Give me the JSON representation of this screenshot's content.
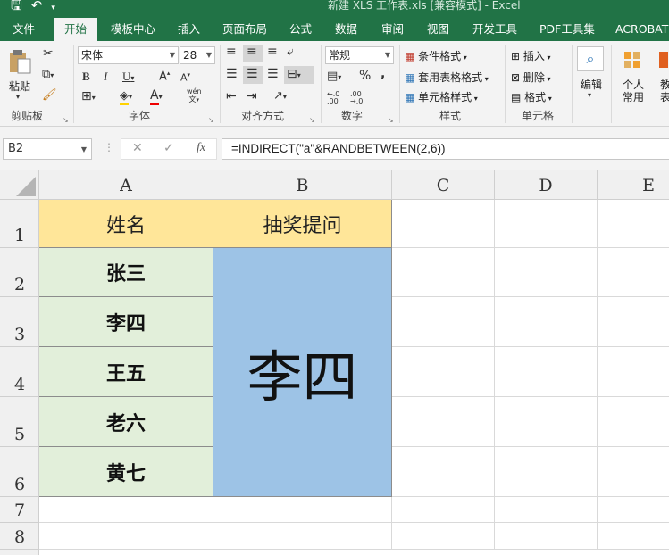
{
  "window": {
    "title": "新建 XLS 工作表.xls  [兼容模式] - Excel"
  },
  "ribbon_tabs": [
    {
      "label": "文件",
      "active": false
    },
    {
      "label": "开始",
      "active": true
    },
    {
      "label": "模板中心",
      "active": false
    },
    {
      "label": "插入",
      "active": false
    },
    {
      "label": "页面布局",
      "active": false
    },
    {
      "label": "公式",
      "active": false
    },
    {
      "label": "数据",
      "active": false
    },
    {
      "label": "审阅",
      "active": false
    },
    {
      "label": "视图",
      "active": false
    },
    {
      "label": "开发工具",
      "active": false
    },
    {
      "label": "PDF工具集",
      "active": false
    },
    {
      "label": "ACROBAT",
      "active": false
    }
  ],
  "ribbon": {
    "clipboard": {
      "paste": "粘贴",
      "label": "剪贴板"
    },
    "font": {
      "name": "宋体",
      "size": "28",
      "label": "字体",
      "phonetic": "wén"
    },
    "alignment": {
      "label": "对齐方式"
    },
    "number": {
      "format": "常规",
      "label": "数字"
    },
    "styles": {
      "conditional": "条件格式",
      "table": "套用表格格式",
      "cell": "单元格样式",
      "label": "样式"
    },
    "cells": {
      "insert": "插入",
      "delete": "删除",
      "format": "格式",
      "label": "单元格"
    },
    "edit": {
      "label": "编辑"
    },
    "personal": {
      "label1": "个人",
      "label2": "常用"
    },
    "extra": {
      "label1": "教",
      "label2": "表"
    }
  },
  "formula_bar": {
    "name_box": "B2",
    "formula": "=INDIRECT(\"a\"&RANDBETWEEN(2,6))"
  },
  "sheet": {
    "columns": [
      "A",
      "B",
      "C",
      "D",
      "E"
    ],
    "rows": [
      "1",
      "2",
      "3",
      "4",
      "5",
      "6",
      "7",
      "8"
    ],
    "A1": "姓名",
    "B1": "抽奖提问",
    "names": [
      "张三",
      "李四",
      "王五",
      "老六",
      "黄七"
    ],
    "B2": "李四"
  },
  "colors": {
    "excel_green": "#217346",
    "header_fill": "#ffe699",
    "name_fill": "#e2efda",
    "result_fill": "#9dc3e6"
  }
}
